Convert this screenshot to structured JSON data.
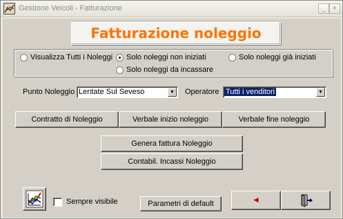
{
  "window": {
    "title": "Gestione Veicoli - Fatturazione",
    "minimize_glyph": "_",
    "close_glyph": "×"
  },
  "header": {
    "title": "Fatturazione noleggio"
  },
  "filter": {
    "options": [
      {
        "label": "Visualizza Tutti i Noleggi",
        "checked": false
      },
      {
        "label": "Solo noleggi non iniziati",
        "checked": true
      },
      {
        "label": "Solo noleggi già iniziati",
        "checked": false
      },
      {
        "label": "Solo noleggi da incassare",
        "checked": false
      }
    ]
  },
  "fields": {
    "punto_label": "Punto Noleggio",
    "punto_value": "Lentate Sul Seveso",
    "operatore_label": "Operatore",
    "operatore_value": "Tutti i venditori",
    "dropdown_glyph": "▼"
  },
  "buttons": {
    "contratto": "Contratto di Noleggio",
    "verbale_inizio": "Verbale inizio noleggio",
    "verbale_fine": "Verbale fine noleggio",
    "genera_fattura": "Genera fattura Noleggio",
    "contabil": "Contabil. Incassi Noleggio",
    "parametri": "Parametri di default",
    "back_glyph": "◄"
  },
  "options": {
    "sempre_visibile": "Sempre visibile",
    "sempre_visibile_checked": false
  },
  "icons": {
    "app": "chart-app-icon",
    "chart_button": "chart-icon",
    "back": "back-arrow-icon",
    "exit": "exit-door-icon"
  },
  "colors": {
    "header_text": "#ff7300",
    "selection": "#0a246a",
    "back_arrow": "#c00000",
    "face": "#d4d0c8"
  }
}
